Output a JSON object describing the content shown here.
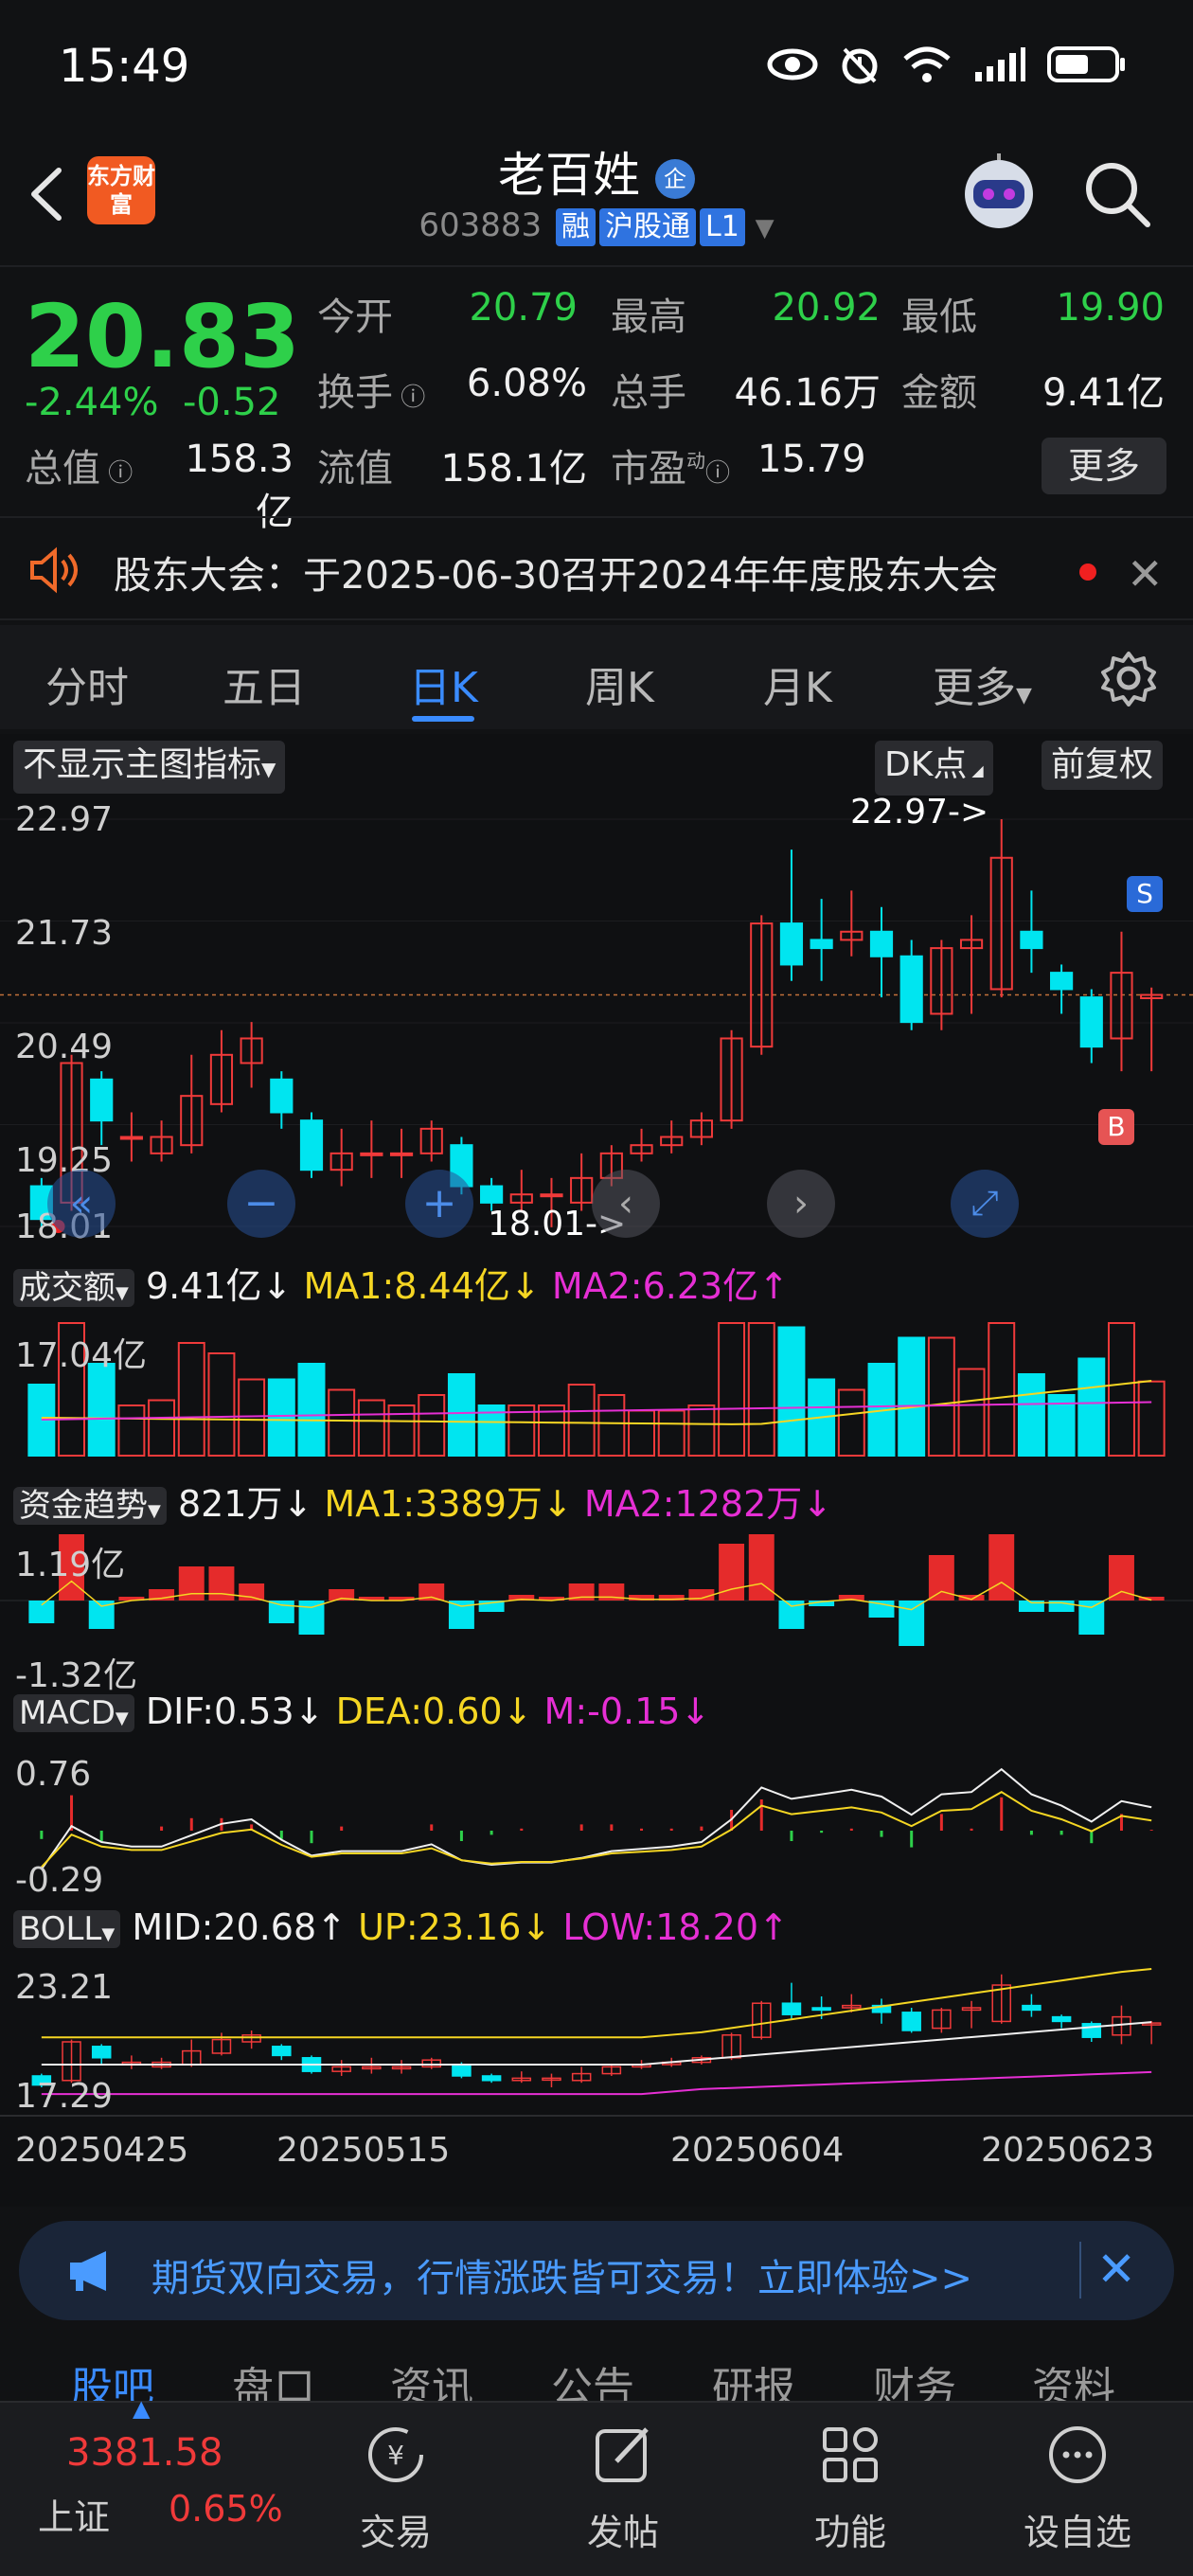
{
  "status_bar": {
    "time": "15:49"
  },
  "header": {
    "logo_text": "东方财富",
    "stock_name": "老百姓",
    "verified_badge": "企",
    "stock_code": "603883",
    "tags": [
      "融",
      "沪股通",
      "L1"
    ]
  },
  "quote": {
    "price": "20.83",
    "change_pct": "-2.44%",
    "change_abs": "-0.52",
    "fields": [
      {
        "label": "今开",
        "value": "20.79",
        "color": "#2ed04a"
      },
      {
        "label": "最高",
        "value": "20.92",
        "color": "#2ed04a"
      },
      {
        "label": "最低",
        "value": "19.90",
        "color": "#2ed04a"
      },
      {
        "label": "换手",
        "value": "6.08%",
        "color": "#f0f0f0"
      },
      {
        "label": "总手",
        "value": "46.16万",
        "color": "#f0f0f0"
      },
      {
        "label": "金额",
        "value": "9.41亿",
        "color": "#f0f0f0"
      },
      {
        "label": "总值",
        "value": "158.3亿",
        "color": "#f0f0f0"
      },
      {
        "label": "流值",
        "value": "158.1亿",
        "color": "#f0f0f0"
      },
      {
        "label": "市盈",
        "value": "15.79",
        "color": "#f0f0f0"
      }
    ],
    "pe_superscript": "动",
    "more_label": "更多"
  },
  "announcement": {
    "text": "股东大会：于2025-06-30召开2024年年度股东大会"
  },
  "period_tabs": [
    "分时",
    "五日",
    "日K",
    "周K",
    "月K",
    "更多"
  ],
  "period_active": 2,
  "chart_controls": {
    "main_indicator": "不显示主图指标",
    "dk_label": "DK点",
    "adjust_label": "前复权"
  },
  "chart_data": [
    {
      "type": "candlestick",
      "title": "日K",
      "y_ticks": [
        "22.97",
        "21.73",
        "20.49",
        "19.25",
        "18.01"
      ],
      "ylim": [
        18.01,
        22.97
      ],
      "annotations": [
        "22.97->",
        "18.01->"
      ],
      "markers": [
        "S",
        "B"
      ],
      "x_labels": [
        "20250425",
        "20250515",
        "20250604",
        "20250623"
      ],
      "candles": [
        {
          "o": 18.5,
          "c": 18.1,
          "h": 18.6,
          "l": 18.0
        },
        {
          "o": 18.3,
          "c": 20.0,
          "h": 20.1,
          "l": 18.2
        },
        {
          "o": 19.8,
          "c": 19.3,
          "h": 19.9,
          "l": 19.0
        },
        {
          "o": 19.1,
          "c": 19.1,
          "h": 19.4,
          "l": 18.8
        },
        {
          "o": 18.9,
          "c": 19.1,
          "h": 19.3,
          "l": 18.8
        },
        {
          "o": 19.0,
          "c": 19.6,
          "h": 20.1,
          "l": 18.9
        },
        {
          "o": 19.5,
          "c": 20.1,
          "h": 20.4,
          "l": 19.4
        },
        {
          "o": 20.0,
          "c": 20.3,
          "h": 20.5,
          "l": 19.7
        },
        {
          "o": 19.8,
          "c": 19.4,
          "h": 19.9,
          "l": 19.2
        },
        {
          "o": 19.3,
          "c": 18.7,
          "h": 19.4,
          "l": 18.6
        },
        {
          "o": 18.7,
          "c": 18.9,
          "h": 19.2,
          "l": 18.5
        },
        {
          "o": 18.9,
          "c": 18.9,
          "h": 19.3,
          "l": 18.6
        },
        {
          "o": 18.9,
          "c": 18.9,
          "h": 19.2,
          "l": 18.6
        },
        {
          "o": 18.9,
          "c": 19.2,
          "h": 19.3,
          "l": 18.8
        },
        {
          "o": 19.0,
          "c": 18.5,
          "h": 19.1,
          "l": 18.4
        },
        {
          "o": 18.5,
          "c": 18.3,
          "h": 18.6,
          "l": 18.2
        },
        {
          "o": 18.3,
          "c": 18.4,
          "h": 18.7,
          "l": 18.2
        },
        {
          "o": 18.4,
          "c": 18.4,
          "h": 18.6,
          "l": 18.0
        },
        {
          "o": 18.3,
          "c": 18.6,
          "h": 18.9,
          "l": 18.2
        },
        {
          "o": 18.6,
          "c": 18.9,
          "h": 19.0,
          "l": 18.5
        },
        {
          "o": 18.9,
          "c": 19.0,
          "h": 19.2,
          "l": 18.8
        },
        {
          "o": 19.0,
          "c": 19.1,
          "h": 19.3,
          "l": 18.9
        },
        {
          "o": 19.1,
          "c": 19.3,
          "h": 19.4,
          "l": 19.0
        },
        {
          "o": 19.3,
          "c": 20.3,
          "h": 20.4,
          "l": 19.2
        },
        {
          "o": 20.2,
          "c": 21.7,
          "h": 21.8,
          "l": 20.1
        },
        {
          "o": 21.7,
          "c": 21.2,
          "h": 22.6,
          "l": 21.0
        },
        {
          "o": 21.5,
          "c": 21.4,
          "h": 22.0,
          "l": 21.0
        },
        {
          "o": 21.5,
          "c": 21.6,
          "h": 22.1,
          "l": 21.3
        },
        {
          "o": 21.6,
          "c": 21.3,
          "h": 21.9,
          "l": 20.8
        },
        {
          "o": 21.3,
          "c": 20.5,
          "h": 21.5,
          "l": 20.4
        },
        {
          "o": 20.6,
          "c": 21.4,
          "h": 21.5,
          "l": 20.4
        },
        {
          "o": 21.4,
          "c": 21.5,
          "h": 21.8,
          "l": 20.6
        },
        {
          "o": 20.9,
          "c": 22.5,
          "h": 22.97,
          "l": 20.8
        },
        {
          "o": 21.6,
          "c": 21.4,
          "h": 22.1,
          "l": 21.1
        },
        {
          "o": 21.1,
          "c": 20.9,
          "h": 21.2,
          "l": 20.6
        },
        {
          "o": 20.8,
          "c": 20.2,
          "h": 20.9,
          "l": 20.0
        },
        {
          "o": 20.3,
          "c": 21.1,
          "h": 21.6,
          "l": 19.9
        },
        {
          "o": 20.79,
          "c": 20.83,
          "h": 20.92,
          "l": 19.9
        }
      ]
    },
    {
      "type": "bar",
      "title": "成交额",
      "value_label": "9.41亿",
      "ma1": "MA1:8.44亿",
      "ma2": "MA2:6.23亿",
      "y_tick": "17.04亿"
    },
    {
      "type": "bar",
      "title": "资金趋势",
      "value_label": "821万",
      "ma1": "MA1:3389万",
      "ma2": "MA2:1282万",
      "y_ticks": [
        "1.19亿",
        "-1.32亿"
      ]
    },
    {
      "type": "line",
      "title": "MACD",
      "dif": "DIF:0.53",
      "dea": "DEA:0.60",
      "m": "M:-0.15",
      "y_ticks": [
        "0.76",
        "-0.29"
      ]
    },
    {
      "type": "line",
      "title": "BOLL",
      "mid": "MID:20.68",
      "up": "UP:23.16",
      "low": "LOW:18.20",
      "y_ticks": [
        "23.21",
        "17.29"
      ]
    }
  ],
  "promo": {
    "text": "期货双向交易，行情涨跌皆可交易！立即体验>>"
  },
  "section_tabs": [
    "股吧",
    "盘口",
    "资讯",
    "公告",
    "研报",
    "财务",
    "资料"
  ],
  "bottom_nav": {
    "index_value": "3381.58",
    "index_name": "上证",
    "index_change": "0.65%",
    "items": [
      "交易",
      "发帖",
      "功能",
      "设自选"
    ]
  },
  "colors": {
    "up": "#f03a3a",
    "down": "#00e5f0",
    "accent": "#3a8bff",
    "price_down": "#2ed04a"
  }
}
